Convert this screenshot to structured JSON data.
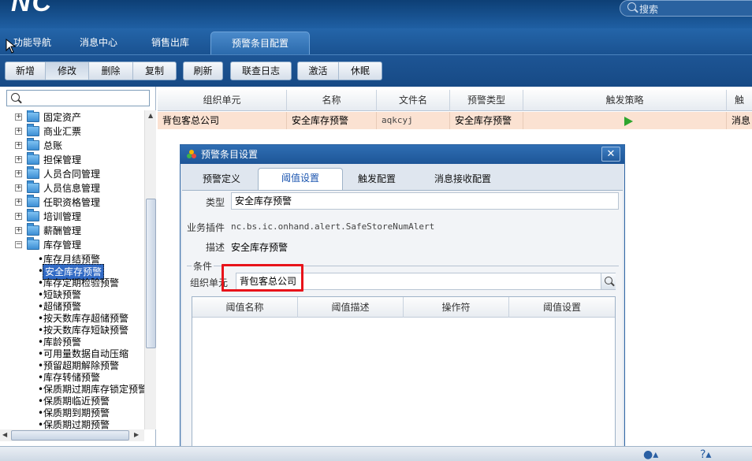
{
  "header": {
    "logo": "NC",
    "search_placeholder": "搜索"
  },
  "main_tabs": [
    {
      "label": "功能导航"
    },
    {
      "label": "消息中心"
    },
    {
      "label": "销售出库"
    },
    {
      "label": "预警条目配置",
      "active": true
    }
  ],
  "toolbar": {
    "group1": [
      "新增",
      "修改",
      "删除",
      "复制"
    ],
    "group2": [
      "刷新"
    ],
    "group3": [
      "联查日志"
    ],
    "group4": [
      "激活",
      "休眠"
    ]
  },
  "tree": {
    "folders": [
      "固定资产",
      "商业汇票",
      "总账",
      "担保管理",
      "人员合同管理",
      "人员信息管理",
      "任职资格管理",
      "培训管理",
      "薪酬管理",
      "库存管理"
    ],
    "leaves": [
      "库存月结预警",
      "安全库存预警",
      "库存定期检验预警",
      "短缺预警",
      "超储预警",
      "按天数库存超储预警",
      "按天数库存短缺预警",
      "库龄预警",
      "可用量数据自动压缩",
      "预留超期解除预警",
      "库存转储预警",
      "保质期过期库存锁定预警",
      "保质期临近预警",
      "保质期到期预警",
      "保质期过期预警"
    ],
    "selected_leaf": "安全库存预警"
  },
  "grid": {
    "columns": [
      "组织单元",
      "名称",
      "文件名",
      "预警类型",
      "触发策略",
      "触"
    ],
    "rows": [
      {
        "org": "背包客总公司",
        "name": "安全库存预警",
        "file": "aqkcyj",
        "type": "安全库存预警",
        "last": "消息"
      }
    ]
  },
  "dialog": {
    "title": "预警条目设置",
    "close": "✕",
    "tabs": [
      "预警定义",
      "阈值设置",
      "触发配置",
      "消息接收配置"
    ],
    "active_tab": "阈值设置",
    "type_label": "类型",
    "type_value": "安全库存预警",
    "plugin_label": "业务插件",
    "plugin_value": "nc.bs.ic.onhand.alert.SafeStoreNumAlert",
    "desc_label": "描述",
    "desc_value": "安全库存预警",
    "condition_label": "条件",
    "org_label": "组织单元",
    "org_value": "背包客总公司",
    "threshold_columns": [
      "阈值名称",
      "阈值描述",
      "操作符",
      "阈值设置"
    ]
  },
  "colors": {
    "highlight": "#e8131a",
    "row_selected": "#fbe2d2",
    "header_blue": "#1f5fa3"
  }
}
